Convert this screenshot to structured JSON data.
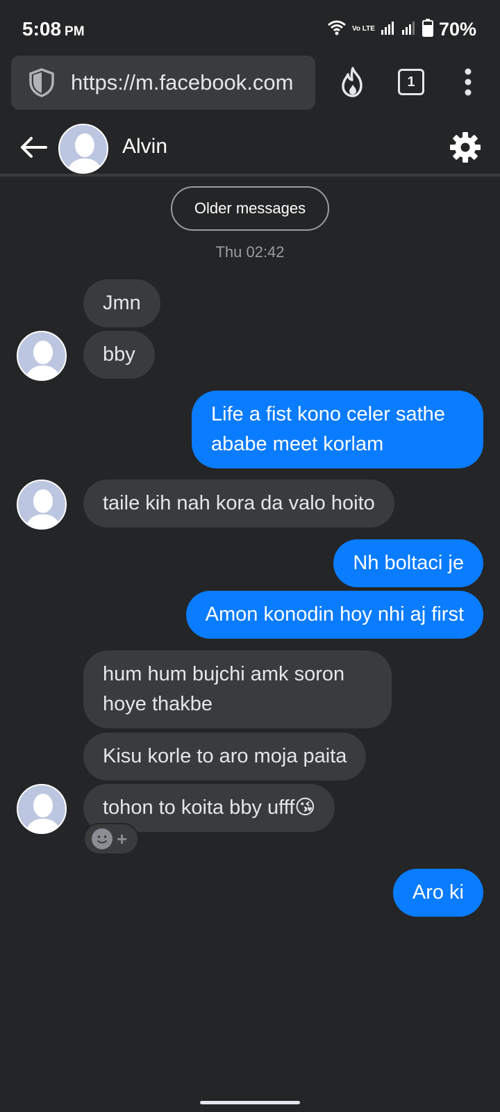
{
  "status_bar": {
    "time": "5:08",
    "ampm": "PM",
    "network_label": "Vo LTE",
    "battery": "70%"
  },
  "browser": {
    "url": "https://m.facebook.com",
    "tab_count": "1"
  },
  "chat": {
    "contact_name": "Alvin",
    "older_messages_label": "Older messages",
    "timestamp": "Thu 02:42",
    "messages": [
      {
        "from": "them",
        "text": "Jmn"
      },
      {
        "from": "them",
        "text": "bby"
      },
      {
        "from": "me",
        "text": "Life a fist kono celer sathe ababe meet korlam"
      },
      {
        "from": "them",
        "text": "taile kih nah kora da valo hoito"
      },
      {
        "from": "me",
        "text": "Nh boltaci je"
      },
      {
        "from": "me",
        "text": "Amon konodin hoy nhi aj first"
      },
      {
        "from": "them",
        "text": "hum hum bujchi amk soron hoye thakbe"
      },
      {
        "from": "them",
        "text": "Kisu korle to aro moja paita"
      },
      {
        "from": "them",
        "text": "tohon to koita bby ufff😘"
      },
      {
        "from": "me",
        "text": "Aro ki"
      }
    ],
    "reaction_plus": "+"
  },
  "colors": {
    "background": "#242526",
    "received_bubble": "#3a3b3c",
    "sent_bubble": "#0a7cff"
  },
  "icons": {
    "shield": "shield-icon",
    "flame": "flame-icon",
    "menu": "more-vertical-icon",
    "back": "back-arrow-icon",
    "settings": "gear-icon"
  }
}
